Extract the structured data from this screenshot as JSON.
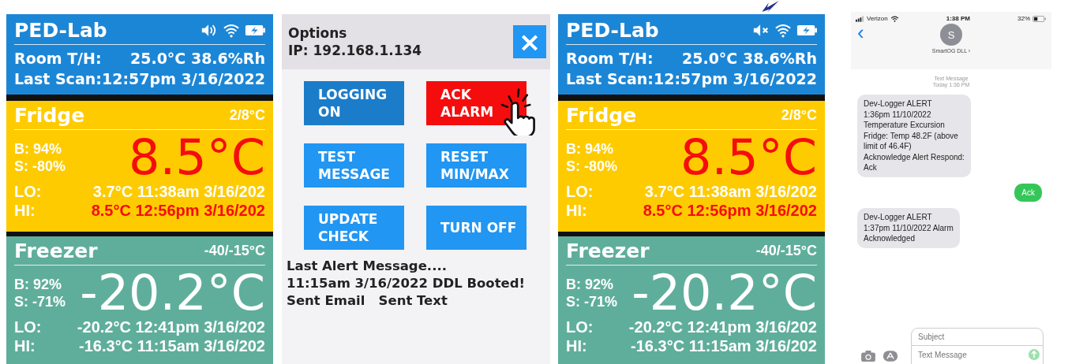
{
  "monitors": [
    {
      "title": "PED-Lab",
      "sound_muted": false,
      "info": [
        {
          "label": "Room T/H:",
          "value": "25.0°C  38.6%Rh"
        },
        {
          "label": "Last Scan:",
          "value": "12:57pm 3/16/2022"
        }
      ],
      "sensors": [
        {
          "name": "Fridge",
          "range": "2/8°C",
          "kind": "fridge",
          "battery": "B:  94%",
          "signal": "S: -80%",
          "reading": "8.5°C",
          "reading_alert": true,
          "lo_label": "LO:",
          "lo": "3.7°C 11:38am 3/16/202",
          "lo_alert": false,
          "hi_label": "HI:",
          "hi": "8.5°C 12:56pm 3/16/202",
          "hi_alert": true
        },
        {
          "name": "Freezer",
          "range": "-40/-15°C",
          "kind": "freezer",
          "battery": "B:  92%",
          "signal": "S:  -71%",
          "reading": "-20.2°C",
          "reading_alert": false,
          "lo_label": "LO:",
          "lo": "-20.2°C 12:41pm 3/16/202",
          "lo_alert": false,
          "hi_label": "HI:",
          "hi": "-16.3°C 11:15am 3/16/202",
          "hi_alert": false
        }
      ]
    },
    {
      "options": {
        "title": "Options",
        "ip": "IP: 192.168.1.134",
        "close": "×",
        "buttons": [
          {
            "label": "LOGGING ON",
            "kind": "on"
          },
          {
            "label": "ACK ALARM",
            "kind": "alarm"
          },
          {
            "label": "TEST MESSAGE",
            "kind": "action"
          },
          {
            "label": "RESET MIN/MAX",
            "kind": "action"
          },
          {
            "label": "UPDATE CHECK",
            "kind": "action"
          },
          {
            "label": "TURN OFF",
            "kind": "action"
          }
        ],
        "last_alert": [
          "Last Alert Message....",
          "11:15am 3/16/2022 DDL Booted!",
          "Sent Email   Sent Text"
        ]
      }
    },
    {
      "title": "PED-Lab",
      "sound_muted": true,
      "info": [
        {
          "label": "Room T/H:",
          "value": "25.0°C  38.6%Rh"
        },
        {
          "label": "Last Scan:",
          "value": "12:57pm 3/16/2022"
        }
      ],
      "sensors": [
        {
          "name": "Fridge",
          "range": "2/8°C",
          "kind": "fridge",
          "battery": "B:  94%",
          "signal": "S: -80%",
          "reading": "8.5°C",
          "reading_alert": true,
          "lo_label": "LO:",
          "lo": "3.7°C 11:38am 3/16/202",
          "lo_alert": false,
          "hi_label": "HI:",
          "hi": "8.5°C 12:56pm 3/16/202",
          "hi_alert": true
        },
        {
          "name": "Freezer",
          "range": "-40/-15°C",
          "kind": "freezer",
          "battery": "B:  92%",
          "signal": "S:  -71%",
          "reading": "-20.2°C",
          "reading_alert": false,
          "lo_label": "LO:",
          "lo": "-20.2°C 12:41pm 3/16/202",
          "lo_alert": false,
          "hi_label": "HI:",
          "hi": "-16.3°C 11:15am 3/16/202",
          "hi_alert": false
        }
      ]
    }
  ],
  "phone": {
    "carrier": "Verizon",
    "time": "1:38 PM",
    "battery": "32%",
    "back": "‹",
    "avatar": "S",
    "contact": "SmartOG DLL ›",
    "thread_label": "Text Message",
    "thread_time": "Today 1:36 PM",
    "messages": [
      {
        "kind": "incoming",
        "lines": [
          "Dev-Logger ALERT",
          "1:36pm 11/10/2022",
          "Temperature Excursion",
          "Fridge: Temp 48.2F (above",
          "limit of 46.4F)",
          "Acknowledge Alert Respond:",
          "Ack"
        ]
      },
      {
        "kind": "outgoing",
        "lines": [
          "Ack"
        ]
      },
      {
        "kind": "incoming",
        "lines": [
          "Dev-Logger ALERT",
          "1:37pm 11/10/2022 Alarm",
          "Acknowledged"
        ]
      }
    ],
    "subject_placeholder": "Subject",
    "message_placeholder": "Text Message"
  }
}
